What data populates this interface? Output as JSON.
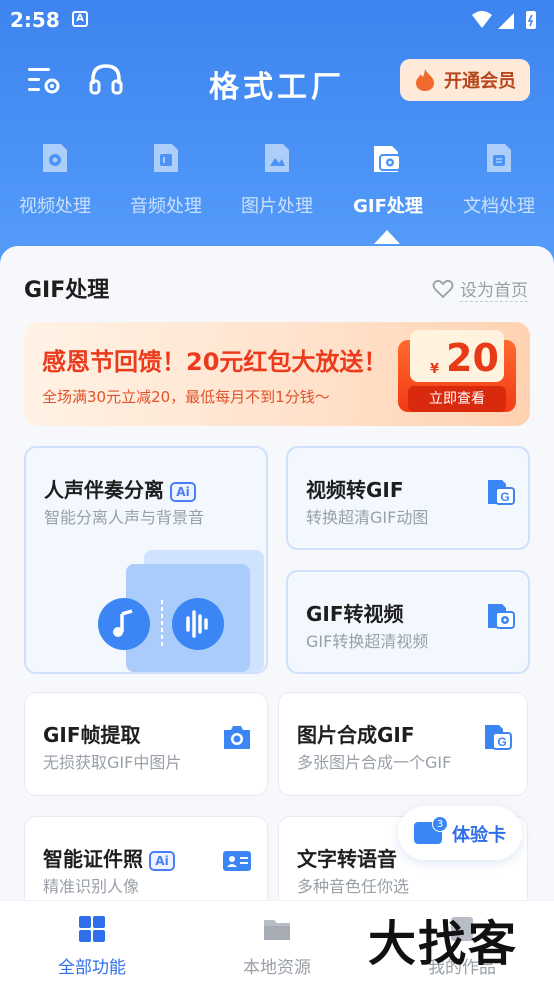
{
  "status_bar": {
    "time": "2:58",
    "notif_letter": "A"
  },
  "header": {
    "title": "格式工厂",
    "vip_label": "开通会员"
  },
  "categories": [
    {
      "label": "视频处理",
      "icon": "video-file-icon"
    },
    {
      "label": "音频处理",
      "icon": "audio-file-icon"
    },
    {
      "label": "图片处理",
      "icon": "image-file-icon"
    },
    {
      "label": "GIF处理",
      "icon": "gif-file-icon",
      "active": true
    },
    {
      "label": "文档处理",
      "icon": "document-file-icon"
    }
  ],
  "section": {
    "title": "GIF处理",
    "set_home": "设为首页"
  },
  "banner": {
    "title": "感恩节回馈！20元红包大放送！",
    "subtitle": "全场满30元立减20，最低每月不到1分钱～",
    "coupon_symbol": "¥",
    "coupon_amount": "20",
    "coupon_button": "立即查看"
  },
  "cards": {
    "vocal_split": {
      "title": "人声伴奏分离",
      "ai": "Ai",
      "subtitle": "智能分离人声与背景音"
    },
    "video_to_gif": {
      "title": "视频转GIF",
      "subtitle": "转换超清GIF动图"
    },
    "gif_to_video": {
      "title": "GIF转视频",
      "subtitle": "GIF转换超清视频"
    },
    "gif_frames": {
      "title": "GIF帧提取",
      "subtitle": "无损获取GIF中图片"
    },
    "images_to_gif": {
      "title": "图片合成GIF",
      "subtitle": "多张图片合成一个GIF"
    },
    "id_photo": {
      "title": "智能证件照",
      "ai": "Ai",
      "subtitle": "精准识别人像"
    },
    "text_to_speech": {
      "title": "文字转语音",
      "subtitle": "多种音色任你选"
    }
  },
  "trial": {
    "label": "体验卡",
    "count": "3"
  },
  "bottom_nav": [
    {
      "label": "全部功能",
      "active": true
    },
    {
      "label": "本地资源"
    },
    {
      "label": "我的作品"
    }
  ],
  "watermark": "大找客",
  "colors": {
    "primary": "#3d84ef",
    "accent_blue": "#2f6fea",
    "promo_red": "#ec3a1d"
  }
}
